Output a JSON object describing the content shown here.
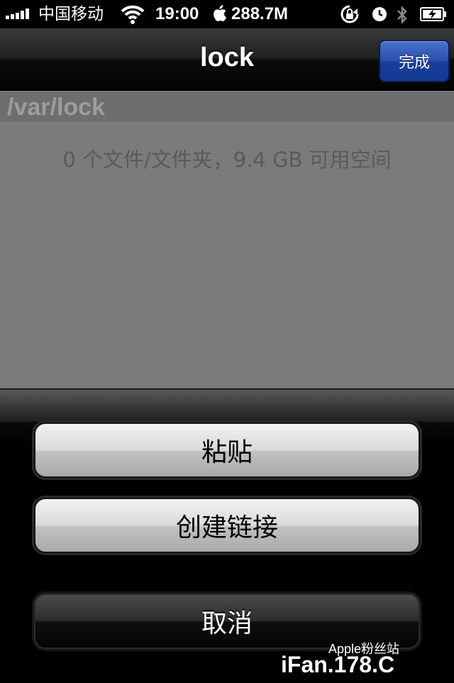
{
  "status_bar": {
    "carrier": "中国移动",
    "time": "19:00",
    "memory": "288.7M",
    "signal_bars": 5
  },
  "nav": {
    "title": "lock",
    "done_label": "完成"
  },
  "directory": {
    "path": "/var/lock",
    "summary": "0 个文件/文件夹，9.4 GB 可用空间"
  },
  "action_sheet": {
    "paste_label": "粘贴",
    "create_link_label": "创建链接",
    "cancel_label": "取消"
  },
  "watermark": {
    "site": "iFan.178.C",
    "tagline": "Apple粉丝站"
  },
  "colors": {
    "done_button": "#2850ad",
    "content_background": "#7b7b7b",
    "path_header_background": "#6d6e70"
  }
}
